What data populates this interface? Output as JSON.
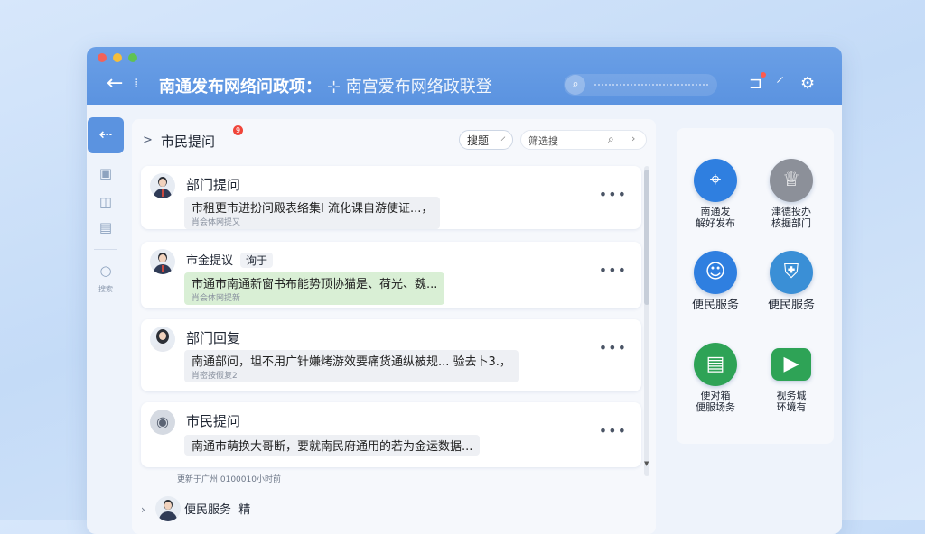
{
  "window": {
    "title": "南通发布网络问政项：",
    "subtitle": "⊹ 南宫爱布网络政联登"
  },
  "titlebar_icons": [
    "back-arrow-icon",
    "drag-handle-icon",
    "search-icon",
    "notification-icon",
    "pin-icon",
    "settings-icon"
  ],
  "panel": {
    "title": "市民提问",
    "badge": "9",
    "filter_label": "搜题",
    "search_placeholder": "筛选搜",
    "footer_note": "更新于广州 0100010小时前"
  },
  "posts": [
    {
      "title": "部门提问",
      "text": "市租更市进扮问殿表络集I 流化课自游使证...，",
      "meta": "肖会体网提又",
      "highlight": false,
      "avatar": "male-avatar"
    },
    {
      "title": "市金提议",
      "tag": "询于",
      "text": "市通市南通新窗书布能势顶协猫是、荷光、魏...",
      "meta": "肖会体网提新",
      "highlight": true,
      "avatar": "male-avatar"
    },
    {
      "title": "部门回复",
      "text": "南通部问，坦不用广针嫌烤游效要痛货通纵被规...  验去卜3.，",
      "meta": "肖密按假复2",
      "highlight": false,
      "avatar": "female-avatar"
    },
    {
      "title": "市民提问",
      "text": "南通市萌换大哥断，要就南民府通用的若为金运数据...",
      "meta": "",
      "highlight": false,
      "avatar": "camera-icon"
    }
  ],
  "bottom_item": {
    "label": "便民服务",
    "tag": "精"
  },
  "services": [
    {
      "label": "南通发\n解好发布",
      "icon": "location-pin-icon",
      "color": "#2f7fe0"
    },
    {
      "label": "津德投办\n核据部门",
      "icon": "trophy-icon",
      "color": "#8c9099"
    },
    {
      "label": "便民服务",
      "icon": "person-shield-icon",
      "color": "#2f7fe0"
    },
    {
      "label": "便民服务",
      "icon": "map-shield-icon",
      "color": "#3a8fd6"
    },
    {
      "label": "便对箱\n便服场务",
      "icon": "document-icon",
      "color": "#2ea356"
    },
    {
      "label": "视务城\n环境有",
      "icon": "video-icon",
      "color": "#2ea356"
    }
  ],
  "nav": {
    "search_label": "搜索"
  }
}
